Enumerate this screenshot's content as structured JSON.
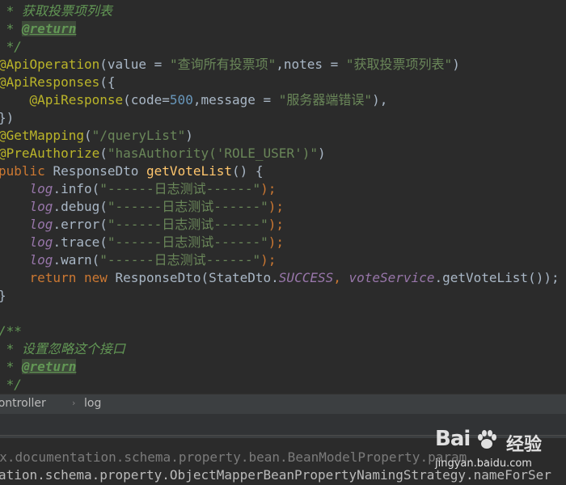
{
  "code_lines": [
    [
      {
        "t": " * ",
        "c": "comment"
      },
      {
        "t": "获取投票项列表",
        "c": "comment"
      }
    ],
    [
      {
        "t": " * ",
        "c": "comment"
      },
      {
        "t": "@return",
        "c": "tag"
      }
    ],
    [
      {
        "t": " */",
        "c": "comment"
      }
    ],
    [
      {
        "t": "@ApiOperation",
        "c": "anno"
      },
      {
        "t": "(value = ",
        "c": "plain"
      },
      {
        "t": "\"查询所有投票项\"",
        "c": "str"
      },
      {
        "t": ",notes = ",
        "c": "plain"
      },
      {
        "t": "\"获取投票项列表\"",
        "c": "str"
      },
      {
        "t": ")",
        "c": "plain"
      }
    ],
    [
      {
        "t": "@ApiResponses",
        "c": "anno"
      },
      {
        "t": "({",
        "c": "plain"
      }
    ],
    [
      {
        "t": "    ",
        "c": "plain"
      },
      {
        "t": "@ApiResponse",
        "c": "anno"
      },
      {
        "t": "(code=",
        "c": "plain"
      },
      {
        "t": "500",
        "c": "num"
      },
      {
        "t": ",message = ",
        "c": "plain"
      },
      {
        "t": "\"服务器端错误\"",
        "c": "str"
      },
      {
        "t": "),",
        "c": "plain"
      }
    ],
    [
      {
        "t": "})",
        "c": "plain"
      }
    ],
    [
      {
        "t": "@GetMapping",
        "c": "anno"
      },
      {
        "t": "(",
        "c": "plain"
      },
      {
        "t": "\"/queryList\"",
        "c": "str"
      },
      {
        "t": ")",
        "c": "plain"
      }
    ],
    [
      {
        "t": "@PreAuthorize",
        "c": "anno"
      },
      {
        "t": "(",
        "c": "plain"
      },
      {
        "t": "\"hasAuthority('ROLE_USER')\"",
        "c": "str"
      },
      {
        "t": ")",
        "c": "plain"
      }
    ],
    [
      {
        "t": "public ",
        "c": "kw"
      },
      {
        "t": "ResponseDto ",
        "c": "plain"
      },
      {
        "t": "getVoteList",
        "c": "method"
      },
      {
        "t": "() {",
        "c": "plain"
      }
    ],
    [
      {
        "t": "    ",
        "c": "plain"
      },
      {
        "t": "log",
        "c": "field"
      },
      {
        "t": ".info(",
        "c": "plain"
      },
      {
        "t": "\"------日志测试------\"",
        "c": "str"
      },
      {
        "t": ");",
        "c": "kw"
      }
    ],
    [
      {
        "t": "    ",
        "c": "plain"
      },
      {
        "t": "log",
        "c": "field"
      },
      {
        "t": ".debug(",
        "c": "plain"
      },
      {
        "t": "\"------日志测试------\"",
        "c": "str"
      },
      {
        "t": ");",
        "c": "kw"
      }
    ],
    [
      {
        "t": "    ",
        "c": "plain"
      },
      {
        "t": "log",
        "c": "field"
      },
      {
        "t": ".error(",
        "c": "plain"
      },
      {
        "t": "\"------日志测试------\"",
        "c": "str"
      },
      {
        "t": ");",
        "c": "kw"
      }
    ],
    [
      {
        "t": "    ",
        "c": "plain"
      },
      {
        "t": "log",
        "c": "field"
      },
      {
        "t": ".trace(",
        "c": "plain"
      },
      {
        "t": "\"------日志测试------\"",
        "c": "str"
      },
      {
        "t": ");",
        "c": "kw"
      }
    ],
    [
      {
        "t": "    ",
        "c": "plain"
      },
      {
        "t": "log",
        "c": "field"
      },
      {
        "t": ".warn(",
        "c": "plain"
      },
      {
        "t": "\"------日志测试------\"",
        "c": "str"
      },
      {
        "t": ");",
        "c": "kw"
      }
    ],
    [
      {
        "t": "    ",
        "c": "plain"
      },
      {
        "t": "return new ",
        "c": "kw"
      },
      {
        "t": "ResponseDto(StateDto.",
        "c": "plain"
      },
      {
        "t": "SUCCESS",
        "c": "field"
      },
      {
        "t": ", ",
        "c": "kw"
      },
      {
        "t": "voteService",
        "c": "field"
      },
      {
        "t": ".getVoteList());",
        "c": "plain"
      }
    ],
    [
      {
        "t": "}",
        "c": "plain"
      }
    ],
    [
      {
        "t": "",
        "c": "plain"
      }
    ],
    [
      {
        "t": "/**",
        "c": "comment"
      }
    ],
    [
      {
        "t": " * ",
        "c": "comment"
      },
      {
        "t": "设置忽略这个接口",
        "c": "comment"
      }
    ],
    [
      {
        "t": " * ",
        "c": "comment"
      },
      {
        "t": "@return",
        "c": "tag"
      }
    ],
    [
      {
        "t": " */",
        "c": "comment"
      }
    ]
  ],
  "breadcrumb": {
    "items": [
      "controller",
      "log"
    ],
    "separator": "›"
  },
  "console_lines": [
    "fox.documentation.schema.property.bean.BeanModelProperty.param...",
    "ation.schema.property.ObjectMapperBeanPropertyNamingStrategy.nameForSer"
  ],
  "watermark": {
    "logo": "Bai",
    "logo_suffix": "经验",
    "url": "jingyan.baidu.com"
  },
  "colors": {
    "background": "#2b2b2b",
    "comment": "#629755",
    "annotation": "#bbb529",
    "string": "#6a8759",
    "keyword": "#cc7832",
    "field": "#9876aa",
    "method": "#ffc66d",
    "number": "#6897bb",
    "text": "#a9b7c6"
  }
}
